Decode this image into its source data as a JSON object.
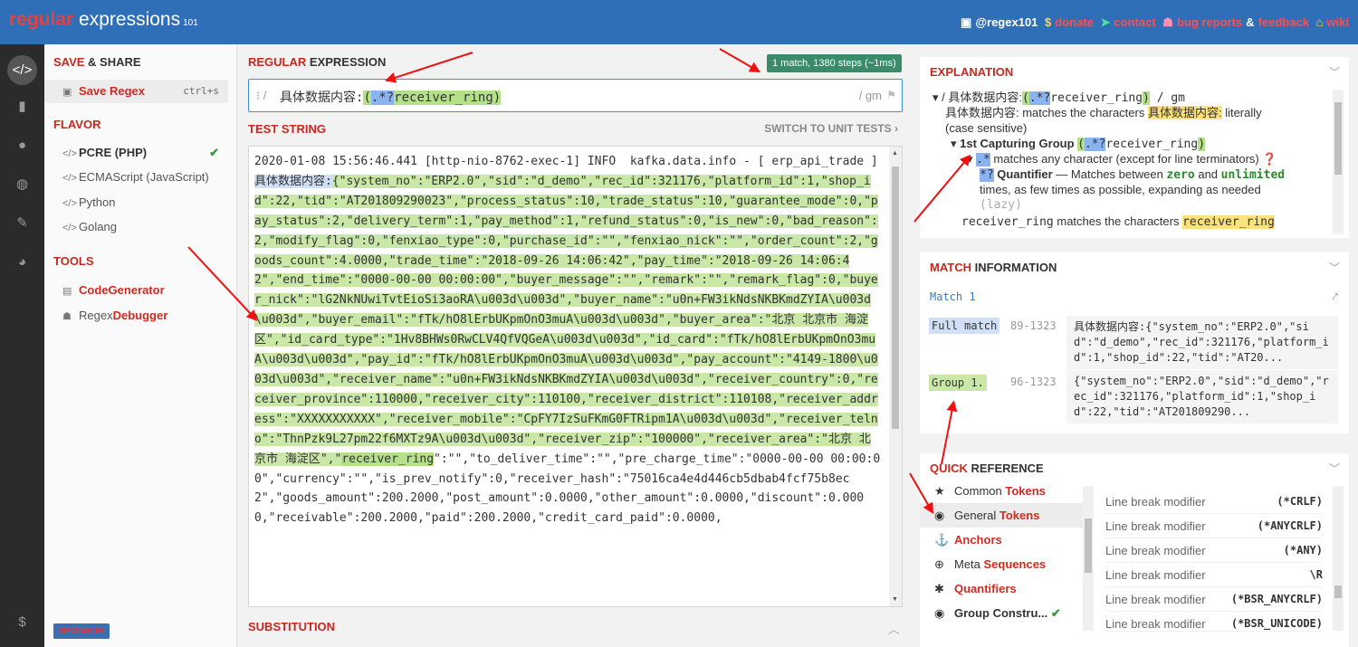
{
  "header": {
    "logo_regular": "regular",
    "logo_expressions": " expressions",
    "logo_version": "101",
    "twitter": "@regex101",
    "donate": "donate",
    "contact": "contact",
    "bug_reports": "bug reports",
    "amp": "&",
    "feedback": "feedback",
    "wiki": "wiki"
  },
  "sidebar": {
    "save_share_a": "SAVE",
    "save_share_b": " & SHARE",
    "save_regex": "Save Regex",
    "save_shortcut": "ctrl+s",
    "flavor": "FLAVOR",
    "flavors": [
      "PCRE (PHP)",
      "ECMAScript (JavaScript)",
      "Python",
      "Golang"
    ],
    "tools": "TOOLS",
    "codegen": "CodeGenerator",
    "debugger_a": "Regex",
    "debugger_b": "Debugger",
    "sponsor": "SPONSOR"
  },
  "regex": {
    "heading_a": "REGULAR",
    "heading_b": " EXPRESSION",
    "match_info": "1 match, 1380 steps (~1ms)",
    "delimiter_open": "/",
    "literal": "具体数据内容:",
    "group_open": "(",
    "token": ".*?",
    "group_rest": "receiver_ring",
    "group_close": ")",
    "flags": "/ gm"
  },
  "test": {
    "heading": "TEST STRING",
    "switch": "SWITCH TO UNIT TESTS ›",
    "pre": "2020-01-08 15:56:46.441 [http-nio-8762-exec-1] INFO  kafka.data.info - [ erp_api_trade ] ",
    "match_label": "具体数据内容:",
    "group_text": "{\"system_no\":\"ERP2.0\",\"sid\":\"d_demo\",\"rec_id\":321176,\"platform_id\":1,\"shop_id\":22,\"tid\":\"AT201809290023\",\"process_status\":10,\"trade_status\":10,\"guarantee_mode\":0,\"pay_status\":2,\"delivery_term\":1,\"pay_method\":1,\"refund_status\":0,\"is_new\":0,\"bad_reason\":2,\"modify_flag\":0,\"fenxiao_type\":0,\"purchase_id\":\"\",\"fenxiao_nick\":\"\",\"order_count\":2,\"goods_count\":4.0000,\"trade_time\":\"2018-09-26 14:06:42\",\"pay_time\":\"2018-09-26 14:06:42\",\"end_time\":\"0000-00-00 00:00:00\",\"buyer_message\":\"\",\"remark\":\"\",\"remark_flag\":0,\"buyer_nick\":\"lG2NkNUwiTvtEioSi3aoRA\\u003d\\u003d\",\"buyer_name\":\"u0n+FW3ikNdsNKBKmdZYIA\\u003d\\u003d\",\"buyer_email\":\"fTk/hO8lErbUKpmOnO3muA\\u003d\\u003d\",\"buyer_area\":\"北京 北京市 海淀区\",\"id_card_type\":\"1Hv8BHWs0RwCLV4QfVQGeA\\u003d\\u003d\",\"id_card\":\"fTk/hO8lErbUKpmOnO3muA\\u003d\\u003d\",\"pay_id\":\"fTk/hO8lErbUKpmOnO3muA\\u003d\\u003d\",\"pay_account\":\"4149-1800\\u003d\\u003d\",\"receiver_name\":\"u0n+FW3ikNdsNKBKmdZYIA\\u003d\\u003d\",\"receiver_country\":0,\"receiver_province\":110000,\"receiver_city\":110100,\"receiver_district\":110108,\"receiver_address\":\"XXXXXXXXXXX\",\"receiver_mobile\":\"CpFY7IzSuFKmG0FTRipm1A\\u003d\\u003d\",\"receiver_telno\":\"ThnPzk9L27pm22f6MXTz9A\\u003d\\u003d\",\"receiver_zip\":\"100000\",\"receiver_area\":\"北京 北京市 海淀区\",\"",
    "group_end": "receiver_ring",
    "post": "\":\"\",\"to_deliver_time\":\"\",\"pre_charge_time\":\"0000-00-00 00:00:00\",\"currency\":\"\",\"is_prev_notify\":0,\"receiver_hash\":\"75016ca4e4d446cb5dbab4fcf75b8ec2\",\"goods_amount\":200.2000,\"post_amount\":0.0000,\"other_amount\":0.0000,\"discount\":0.0000,\"receivable\":200.2000,\"paid\":200.2000,\"credit_card_paid\":0.0000,",
    "substitution": "SUBSTITUTION"
  },
  "explanation": {
    "heading": "EXPLANATION",
    "line1_pre": "/ 具体数据内容:",
    "line1_suffix": "receiver_ring",
    "line1_flags": ") / gm",
    "line2_literal": "具体数据内容:",
    "line2_pre": "具体数据内容: matches the characters ",
    "line2_post": " literally",
    "line3": "(case sensitive)",
    "group_title": "1st Capturing Group",
    "group_expr_tail": "receiver_ring",
    "dot_token": ".*",
    "dot_desc": " matches any character (except for line terminators)",
    "quant_token": "*?",
    "quant_title": "Quantifier",
    "quant_desc_a": " — Matches between ",
    "zero": "zero",
    "and": " and ",
    "unlimited": "unlimited",
    "quant_desc_b": "times, as few times as possible, expanding as needed",
    "lazy": "(lazy)",
    "rr_pre": "receiver_ring matches the characters ",
    "rr_token": "receiver_ring"
  },
  "match_information": {
    "heading_a": "MATCH",
    "heading_b": " INFORMATION",
    "match_label": "Match 1",
    "rows": [
      {
        "label": "Full match",
        "range": "89-1323",
        "value": "具体数据内容:{\"system_no\":\"ERP2.0\",\"sid\":\"d_demo\",\"rec_id\":321176,\"platform_id\":1,\"shop_id\":22,\"tid\":\"AT20..."
      },
      {
        "label": "Group 1.",
        "range": "96-1323",
        "value": "{\"system_no\":\"ERP2.0\",\"sid\":\"d_demo\",\"rec_id\":321176,\"platform_id\":1,\"shop_id\":22,\"tid\":\"AT201809290..."
      }
    ]
  },
  "quick_reference": {
    "heading_a": "QUICK",
    "heading_b": " REFERENCE",
    "categories": [
      {
        "a": "Common ",
        "b": "Tokens"
      },
      {
        "a": "General ",
        "b": "Tokens"
      },
      {
        "a": "",
        "b": "Anchors"
      },
      {
        "a": "Meta ",
        "b": "Sequences"
      },
      {
        "a": "",
        "b": "Quantifiers"
      },
      {
        "a": "Group Constru...",
        "b": ""
      }
    ],
    "tokens": [
      {
        "name": "Line break modifier",
        "code": "(*CRLF)"
      },
      {
        "name": "Line break modifier",
        "code": "(*ANYCRLF)"
      },
      {
        "name": "Line break modifier",
        "code": "(*ANY)"
      },
      {
        "name": "Line break modifier",
        "code": "\\R"
      },
      {
        "name": "Line break modifier",
        "code": "(*BSR_ANYCRLF)"
      },
      {
        "name": "Line break modifier",
        "code": "(*BSR_UNICODE)"
      }
    ]
  }
}
